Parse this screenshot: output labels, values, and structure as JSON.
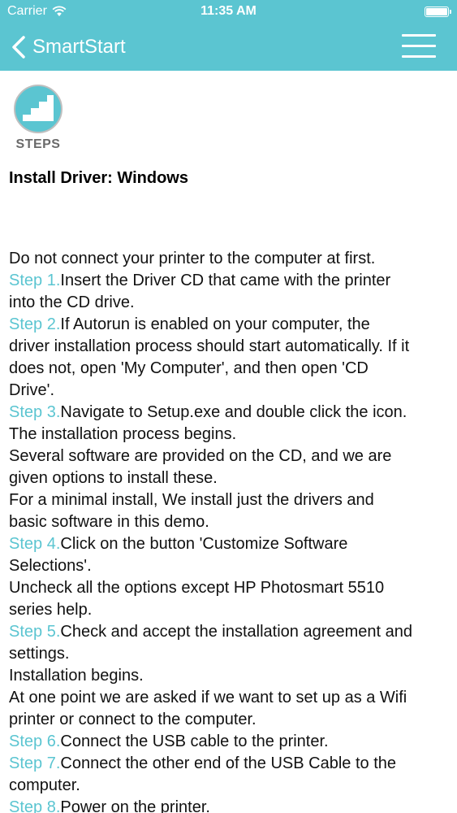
{
  "status_bar": {
    "carrier": "Carrier",
    "time": "11:35 AM"
  },
  "navbar": {
    "back_label": "SmartStart"
  },
  "logo": {
    "label": "STEPS"
  },
  "page_title": "Install Driver: Windows",
  "colors": {
    "accent": "#5bc5d1",
    "header_bg": "#5bc5d1",
    "text": "#111111"
  },
  "lines": [
    {
      "step": "",
      "text": "Do not connect your printer to the computer at first."
    },
    {
      "step": "Step 1.",
      "text": "Insert the Driver CD that came with the printer"
    },
    {
      "step": "",
      "text": "into the CD drive."
    },
    {
      "step": "Step 2.",
      "text": "If Autorun is enabled on your computer, the"
    },
    {
      "step": "",
      "text": "driver installation process should start automatically. If it"
    },
    {
      "step": "",
      "text": "does not, open 'My Computer', and then open 'CD"
    },
    {
      "step": "",
      "text": "Drive'."
    },
    {
      "step": "Step 3.",
      "text": "Navigate to Setup.exe and double click the icon."
    },
    {
      "step": "",
      "text": "The installation process begins."
    },
    {
      "step": "",
      "text": "Several software are provided on the CD, and we are"
    },
    {
      "step": "",
      "text": "given options to install these."
    },
    {
      "step": "",
      "text": "For a minimal install, We install just the drivers and"
    },
    {
      "step": "",
      "text": "basic software in this demo."
    },
    {
      "step": "Step 4.",
      "text": "Click on the button 'Customize Software"
    },
    {
      "step": "",
      "text": "Selections'."
    },
    {
      "step": "",
      "text": "Uncheck all the options except HP Photosmart 5510"
    },
    {
      "step": "",
      "text": "series help."
    },
    {
      "step": "Step 5.",
      "text": "Check and accept the installation agreement and"
    },
    {
      "step": "",
      "text": "settings."
    },
    {
      "step": "",
      "text": "Installation begins."
    },
    {
      "step": "",
      "text": "At one point we are asked if we want to set up as a Wifi"
    },
    {
      "step": "",
      "text": "printer or connect to the computer."
    },
    {
      "step": "Step 6.",
      "text": "Connect the USB cable to the printer."
    },
    {
      "step": "Step 7.",
      "text": "Connect the other end of the USB Cable to the"
    },
    {
      "step": "",
      "text": "computer."
    },
    {
      "step": "Step 8.",
      "text": "Power on the printer."
    }
  ]
}
